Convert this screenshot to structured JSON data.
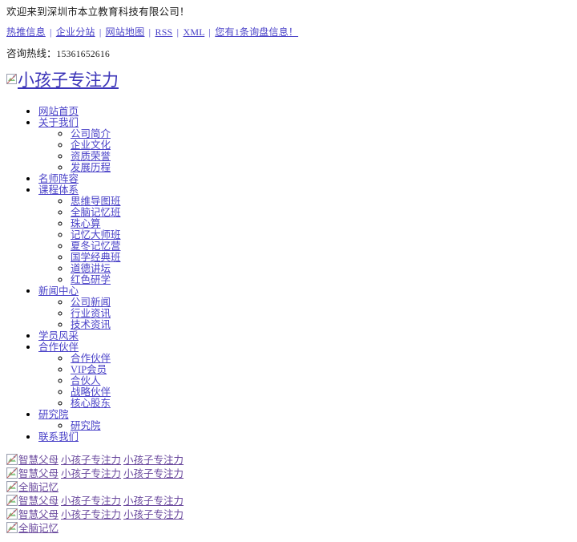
{
  "topbar": {
    "welcome": "欢迎来到深圳市本立教育科技有限公司！",
    "links": [
      {
        "label": "热推信息",
        "name": "hot-info-link"
      },
      {
        "label": "企业分站",
        "name": "branch-site-link"
      },
      {
        "label": "网站地图",
        "name": "sitemap-link"
      },
      {
        "label": "RSS",
        "name": "rss-link"
      },
      {
        "label": "XML",
        "name": "xml-link"
      },
      {
        "label": "您有1条询盘信息！",
        "name": "inquiry-message-link"
      }
    ],
    "separator": "|",
    "hotline_label": "咨询热线：",
    "hotline_number": "15361652616"
  },
  "logo": {
    "alt": "小孩子专注力",
    "icon": "broken-image-icon"
  },
  "nav": [
    {
      "label": "网站首页",
      "children": []
    },
    {
      "label": "关于我们",
      "children": [
        {
          "label": "公司简介"
        },
        {
          "label": "企业文化"
        },
        {
          "label": "资质荣誉"
        },
        {
          "label": "发展历程"
        }
      ]
    },
    {
      "label": "名师阵容",
      "children": []
    },
    {
      "label": "课程体系",
      "children": [
        {
          "label": "思维导图班"
        },
        {
          "label": "全脑记忆班"
        },
        {
          "label": "珠心算"
        },
        {
          "label": "记忆大师班"
        },
        {
          "label": "夏冬记忆营"
        },
        {
          "label": "国学经典班"
        },
        {
          "label": "道德讲坛"
        },
        {
          "label": "红色研学"
        }
      ]
    },
    {
      "label": "新闻中心",
      "children": [
        {
          "label": "公司新闻"
        },
        {
          "label": "行业资讯"
        },
        {
          "label": "技术资讯"
        }
      ]
    },
    {
      "label": "学员风采",
      "children": []
    },
    {
      "label": "合作伙伴",
      "children": [
        {
          "label": "合作伙伴"
        },
        {
          "label": "VIP会员"
        },
        {
          "label": "合伙人"
        },
        {
          "label": "战略伙伴"
        },
        {
          "label": "核心股东"
        }
      ]
    },
    {
      "label": "研究院",
      "children": [
        {
          "label": "研究院"
        }
      ]
    },
    {
      "label": "联系我们",
      "children": []
    }
  ],
  "bottom_image_rows": [
    {
      "alts": [
        "智慧父母",
        "小孩子专注力",
        "小孩子专注力"
      ]
    },
    {
      "alts": [
        "智慧父母",
        "小孩子专注力",
        "小孩子专注力"
      ]
    },
    {
      "alts": [
        "全脑记忆"
      ]
    },
    {
      "alts": [
        "智慧父母",
        "小孩子专注力",
        "小孩子专注力"
      ]
    },
    {
      "alts": [
        "智慧父母",
        "小孩子专注力",
        "小孩子专注力"
      ]
    },
    {
      "alts": [
        "全脑记忆"
      ]
    }
  ],
  "colors": {
    "link": "#4a42c8",
    "visited_link": "#6b4a9e",
    "logo_link": "#3b34b8",
    "text": "#1a1a1a",
    "background": "#ffffff"
  }
}
